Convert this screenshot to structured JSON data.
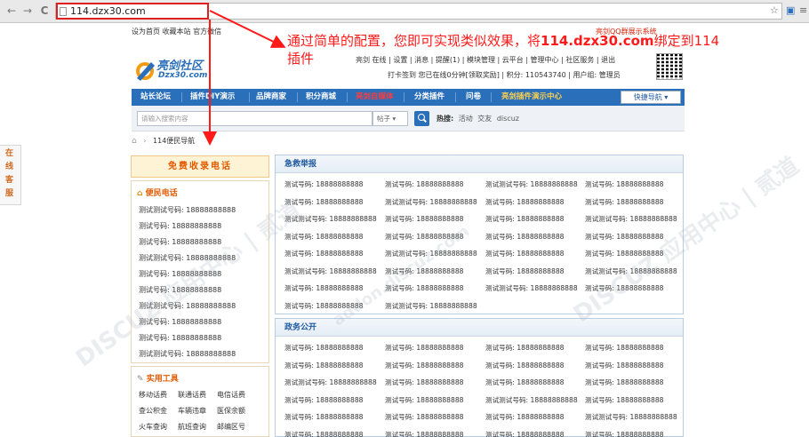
{
  "browser": {
    "url": "114.dzx30.com",
    "back_icon": "←",
    "forward_icon": "→",
    "reload_icon": "C"
  },
  "toplinks": "设为首页 收藏本站 官方微信",
  "annotation": {
    "line1_prefix": "通过简单的配置，您即可实现类似效果，将",
    "domain": "114.dzx30.com",
    "line1_suffix": "绑定到114",
    "line2": "插件"
  },
  "logo": {
    "name": "亮剑社区",
    "sub": "Dzx30.com"
  },
  "demo_badge": "亮剑QQ群展示系统",
  "userbar": {
    "row1": "亮剑 在线 | 设置 | 消息 | 提醒(1) | 模块管理 | 云平台 | 管理中心 | 社区服务 | 退出",
    "row2": "打卡签到 您已在线0分钟[领取奖励] | 积分: 110543740 | 用户组: 管理员"
  },
  "nav": {
    "items": [
      "站长论坛",
      "插件DIY演示",
      "品牌商家",
      "积分商城",
      "亮剑自媒体",
      "分类插件",
      "问卷",
      "亮剑插件演示中心"
    ],
    "quick": "快捷导航 ▾"
  },
  "search": {
    "placeholder": "请输入搜索内容",
    "select": "帖子 ▾",
    "hot_label": "热搜:",
    "hot": [
      "活动",
      "交友",
      "discuz"
    ]
  },
  "breadcrumb": {
    "home_icon": "⌂",
    "sep": "›",
    "current": "114便民导航"
  },
  "side_tab": {
    "chars": [
      "在",
      "线",
      "客",
      "服"
    ]
  },
  "left": {
    "header": "免费收录电话",
    "phone_title": "便民电话",
    "phones": [
      "测试测试号码: 18888888888",
      "测试号码: 18888888888",
      "测试号码: 18888888888",
      "测试测试号码: 18888888888",
      "测试号码: 18888888888",
      "测试号码: 18888888888",
      "测试测试号码: 18888888888",
      "测试号码: 18888888888",
      "测试号码: 18888888888",
      "测试测试号码: 18888888888"
    ],
    "tools_title": "实用工具",
    "tools": [
      [
        "移动话费",
        "联通话费",
        "电信话费"
      ],
      [
        "查公积金",
        "车辆违章",
        "医保余额"
      ],
      [
        "火车查询",
        "航班查询",
        "邮编区号"
      ]
    ]
  },
  "sections": [
    {
      "title": "急救举报",
      "rows": [
        [
          "测试号码: 18888888888",
          "测试号码: 18888888888",
          "测试测试号码: 18888888888",
          "测试号码: 18888888888"
        ],
        [
          "测试号码: 18888888888",
          "测试测试号码: 18888888888",
          "测试号码: 18888888888",
          "测试号码: 18888888888"
        ],
        [
          "测试测试号码: 18888888888",
          "测试号码: 18888888888",
          "测试号码: 18888888888",
          "测试测试号码: 18888888888"
        ],
        [
          "测试号码: 18888888888",
          "测试号码: 18888888888",
          "测试号码: 18888888888",
          "测试号码: 18888888888"
        ],
        [
          "测试号码: 18888888888",
          "测试测试号码: 18888888888",
          "测试号码: 18888888888",
          "测试号码: 18888888888"
        ],
        [
          "测试测试号码: 18888888888",
          "测试号码: 18888888888",
          "测试号码: 18888888888",
          "测试测试号码: 18888888888"
        ],
        [
          "测试号码: 18888888888",
          "测试号码: 18888888888",
          "测试测试号码: 18888888888",
          "测试号码: 18888888888"
        ],
        [
          "测试号码: 18888888888",
          "测试测试号码: 18888888888"
        ]
      ]
    },
    {
      "title": "政务公开",
      "rows": [
        [
          "测试号码: 18888888888",
          "测试号码: 18888888888",
          "测试号码: 18888888888",
          "测试号码: 18888888888"
        ],
        [
          "测试号码: 18888888888",
          "测试号码: 18888888888",
          "测试号码: 18888888888",
          "测试号码: 18888888888"
        ],
        [
          "测试测试号码: 18888888888",
          "测试号码: 18888888888",
          "测试号码: 18888888888",
          "测试号码: 18888888888"
        ],
        [
          "测试号码: 18888888888",
          "测试号码: 18888888888",
          "测试测试号码: 18888888888",
          "测试号码: 18888888888"
        ],
        [
          "测试号码: 18888888888",
          "测试号码: 18888888888",
          "测试号码: 18888888888",
          "测试测试号码: 18888888888"
        ],
        [
          "测试号码: 18888888888",
          "测试号码: 18888888888",
          "测试号码: 18888888888",
          "测试号码: 18888888888"
        ],
        [
          "测试测试号码: 18888888888",
          "测试测试号码: 18888888888",
          "测试号码: 18888888888",
          "测试测试号码: 18888888888"
        ]
      ]
    }
  ],
  "watermarks": [
    "DISCUZ 应用中心 | 贰道",
    "addon.discuz.com",
    "DISCUZ 应用中心 | 贰道"
  ],
  "colors": {
    "nav": "#2a6fba",
    "accent": "#e35a00",
    "annotation": "#ff1a1a"
  }
}
